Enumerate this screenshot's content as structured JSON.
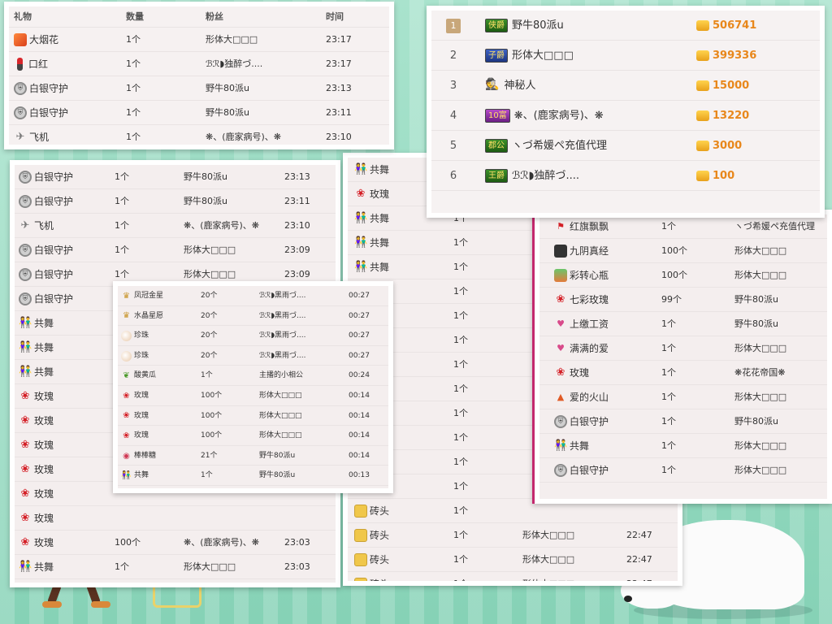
{
  "panel1": {
    "headers": {
      "gift": "礼物",
      "qty": "数量",
      "fan": "粉丝",
      "time": "时间"
    },
    "rows": [
      {
        "icon": "firework-icon",
        "gift": "大烟花",
        "qty": "1个",
        "fan": "形体大□□□",
        "time": "23:17"
      },
      {
        "icon": "lipstick-icon",
        "gift": "口红",
        "qty": "1个",
        "fan": "ℬℛ◗独醉づ....",
        "time": "23:17"
      },
      {
        "icon": "shield-icon",
        "gift": "白银守护",
        "qty": "1个",
        "fan": "野牛80派u",
        "time": "23:13"
      },
      {
        "icon": "shield-icon",
        "gift": "白银守护",
        "qty": "1个",
        "fan": "野牛80派u",
        "time": "23:11"
      },
      {
        "icon": "plane-icon",
        "gift": "飞机",
        "qty": "1个",
        "fan": "❋、(鹿家病号)、❋",
        "time": "23:10"
      }
    ]
  },
  "panel2": {
    "rows": [
      {
        "icon": "shield-icon",
        "gift": "白银守护",
        "qty": "1个",
        "fan": "野牛80派u",
        "time": "23:13"
      },
      {
        "icon": "shield-icon",
        "gift": "白银守护",
        "qty": "1个",
        "fan": "野牛80派u",
        "time": "23:11"
      },
      {
        "icon": "plane-icon",
        "gift": "飞机",
        "qty": "1个",
        "fan": "❋、(鹿家病号)、❋",
        "time": "23:10"
      },
      {
        "icon": "shield-icon",
        "gift": "白银守护",
        "qty": "1个",
        "fan": "形体大□□□",
        "time": "23:09"
      },
      {
        "icon": "shield-icon",
        "gift": "白银守护",
        "qty": "1个",
        "fan": "形体大□□□",
        "time": "23:09"
      },
      {
        "icon": "shield-icon",
        "gift": "白银守护",
        "qty": "",
        "fan": "",
        "time": ""
      },
      {
        "icon": "dance-icon",
        "gift": "共舞",
        "qty": "",
        "fan": "",
        "time": ""
      },
      {
        "icon": "dance-icon",
        "gift": "共舞",
        "qty": "",
        "fan": "",
        "time": ""
      },
      {
        "icon": "dance-icon",
        "gift": "共舞",
        "qty": "",
        "fan": "",
        "time": ""
      },
      {
        "icon": "rose-icon",
        "gift": "玫瑰",
        "qty": "",
        "fan": "",
        "time": ""
      },
      {
        "icon": "rose-icon",
        "gift": "玫瑰",
        "qty": "",
        "fan": "",
        "time": ""
      },
      {
        "icon": "rose-icon",
        "gift": "玫瑰",
        "qty": "",
        "fan": "",
        "time": ""
      },
      {
        "icon": "rose-icon",
        "gift": "玫瑰",
        "qty": "",
        "fan": "",
        "time": ""
      },
      {
        "icon": "rose-icon",
        "gift": "玫瑰",
        "qty": "",
        "fan": "",
        "time": ""
      },
      {
        "icon": "rose-icon",
        "gift": "玫瑰",
        "qty": "",
        "fan": "",
        "time": ""
      },
      {
        "icon": "rose-icon",
        "gift": "玫瑰",
        "qty": "100个",
        "fan": "❋、(鹿家病号)、❋",
        "time": "23:03"
      },
      {
        "icon": "dance-icon",
        "gift": "共舞",
        "qty": "1个",
        "fan": "形体大□□□",
        "time": "23:03"
      },
      {
        "icon": "rose-icon",
        "gift": "玫瑰",
        "qty": "100个",
        "fan": "❋、(鹿家病号)、❋",
        "time": "23:03"
      }
    ]
  },
  "panel3": {
    "rows": [
      {
        "icon": "crown-icon",
        "gift": "凤冠金星",
        "qty": "20个",
        "fan": "ℬℛ◗黑雨づ....",
        "time": "00:27"
      },
      {
        "icon": "crown-icon",
        "gift": "水晶星愿",
        "qty": "20个",
        "fan": "ℬℛ◗黑雨づ....",
        "time": "00:27"
      },
      {
        "icon": "pearl-icon",
        "gift": "珍珠",
        "qty": "20个",
        "fan": "ℬℛ◗黑雨づ....",
        "time": "00:27"
      },
      {
        "icon": "pearl-icon",
        "gift": "珍珠",
        "qty": "20个",
        "fan": "ℬℛ◗黑雨づ....",
        "time": "00:27"
      },
      {
        "icon": "cucumber-icon",
        "gift": "酸黄瓜",
        "qty": "1个",
        "fan": "主播的小相公",
        "time": "00:24"
      },
      {
        "icon": "rose-icon",
        "gift": "玫瑰",
        "qty": "100个",
        "fan": "形体大□□□",
        "time": "00:14"
      },
      {
        "icon": "rose-icon",
        "gift": "玫瑰",
        "qty": "100个",
        "fan": "形体大□□□",
        "time": "00:14"
      },
      {
        "icon": "rose-icon",
        "gift": "玫瑰",
        "qty": "100个",
        "fan": "形体大□□□",
        "time": "00:14"
      },
      {
        "icon": "lollipop-icon",
        "gift": "棒棒糖",
        "qty": "21个",
        "fan": "野牛80派u",
        "time": "00:14"
      },
      {
        "icon": "dance-icon",
        "gift": "共舞",
        "qty": "1个",
        "fan": "野牛80派u",
        "time": "00:13"
      }
    ]
  },
  "panel4": {
    "rows": [
      {
        "icon": "dance-icon",
        "gift": "共舞",
        "qty": "",
        "fan": "",
        "time": ""
      },
      {
        "icon": "rose-icon",
        "gift": "玫瑰",
        "qty": "",
        "fan": "",
        "time": ""
      },
      {
        "icon": "dance-icon",
        "gift": "共舞",
        "qty": "1个",
        "fan": "",
        "time": ""
      },
      {
        "icon": "dance-icon",
        "gift": "共舞",
        "qty": "1个",
        "fan": "",
        "time": ""
      },
      {
        "icon": "dance-icon",
        "gift": "共舞",
        "qty": "1个",
        "fan": "",
        "time": ""
      },
      {
        "icon": "",
        "gift": "",
        "qty": "1个",
        "fan": "",
        "time": ""
      },
      {
        "icon": "",
        "gift": "",
        "qty": "1个",
        "fan": "",
        "time": ""
      },
      {
        "icon": "",
        "gift": "",
        "qty": "1个",
        "fan": "",
        "time": ""
      },
      {
        "icon": "",
        "gift": "",
        "qty": "1个",
        "fan": "",
        "time": ""
      },
      {
        "icon": "",
        "gift": "",
        "qty": "1个",
        "fan": "",
        "time": ""
      },
      {
        "icon": "",
        "gift": "",
        "qty": "1个",
        "fan": "",
        "time": ""
      },
      {
        "icon": "",
        "gift": "",
        "qty": "1个",
        "fan": "",
        "time": ""
      },
      {
        "icon": "",
        "gift": "",
        "qty": "1个",
        "fan": "",
        "time": ""
      },
      {
        "icon": "",
        "gift": "",
        "qty": "1个",
        "fan": "",
        "time": ""
      },
      {
        "icon": "brick-icon",
        "gift": "砖头",
        "qty": "1个",
        "fan": "",
        "time": ""
      },
      {
        "icon": "brick-icon",
        "gift": "砖头",
        "qty": "1个",
        "fan": "形体大□□□",
        "time": "22:47"
      },
      {
        "icon": "brick-icon",
        "gift": "砖头",
        "qty": "1个",
        "fan": "形体大□□□",
        "time": "22:47"
      },
      {
        "icon": "brick-icon",
        "gift": "砖头",
        "qty": "1个",
        "fan": "形体大□□□",
        "time": "22:47"
      }
    ]
  },
  "ranking": {
    "rows": [
      {
        "rank": "1",
        "badge": "侠爵",
        "badge_style": "gold",
        "name": "野牛80派u",
        "score": "506741"
      },
      {
        "rank": "2",
        "badge": "子爵",
        "badge_style": "blue",
        "name": "形体大□□□",
        "score": "399336"
      },
      {
        "rank": "3",
        "badge": "",
        "badge_style": "mystery",
        "name": "神秘人",
        "score": "15000"
      },
      {
        "rank": "4",
        "badge": "10富",
        "badge_style": "purple",
        "name": "❋、(鹿家病号)、❋",
        "score": "13220"
      },
      {
        "rank": "5",
        "badge": "郡公",
        "badge_style": "gold",
        "name": "ヽづ希媛ペ充值代理",
        "score": "3000"
      },
      {
        "rank": "6",
        "badge": "王爵",
        "badge_style": "gold",
        "name": "ℬℛ◗独醉づ....",
        "score": "100"
      }
    ]
  },
  "panel6": {
    "rows": [
      {
        "icon": "flag-icon",
        "gift": "红旗飘飘",
        "qty": "1个",
        "fan": "ヽづ希媛ペ充值代理"
      },
      {
        "icon": "book-icon",
        "gift": "九阴真经",
        "qty": "100个",
        "fan": "形体大□□□"
      },
      {
        "icon": "bottle-icon",
        "gift": "彩转心瓶",
        "qty": "100个",
        "fan": "形体大□□□"
      },
      {
        "icon": "rose-icon",
        "gift": "七彩玫瑰",
        "qty": "99个",
        "fan": "野牛80派u"
      },
      {
        "icon": "balloon-icon",
        "gift": "上缴工资",
        "qty": "1个",
        "fan": "野牛80派u"
      },
      {
        "icon": "balloon-icon",
        "gift": "满满的爱",
        "qty": "1个",
        "fan": "形体大□□□"
      },
      {
        "icon": "rose-icon",
        "gift": "玫瑰",
        "qty": "1个",
        "fan": "❋花花帝国❋"
      },
      {
        "icon": "volcano-icon",
        "gift": "爱的火山",
        "qty": "1个",
        "fan": "形体大□□□"
      },
      {
        "icon": "shield-icon",
        "gift": "白银守护",
        "qty": "1个",
        "fan": "野牛80派u"
      },
      {
        "icon": "dance-icon",
        "gift": "共舞",
        "qty": "1个",
        "fan": "形体大□□□"
      },
      {
        "icon": "shield-icon",
        "gift": "白银守护",
        "qty": "1个",
        "fan": "形体大□□□"
      }
    ]
  }
}
